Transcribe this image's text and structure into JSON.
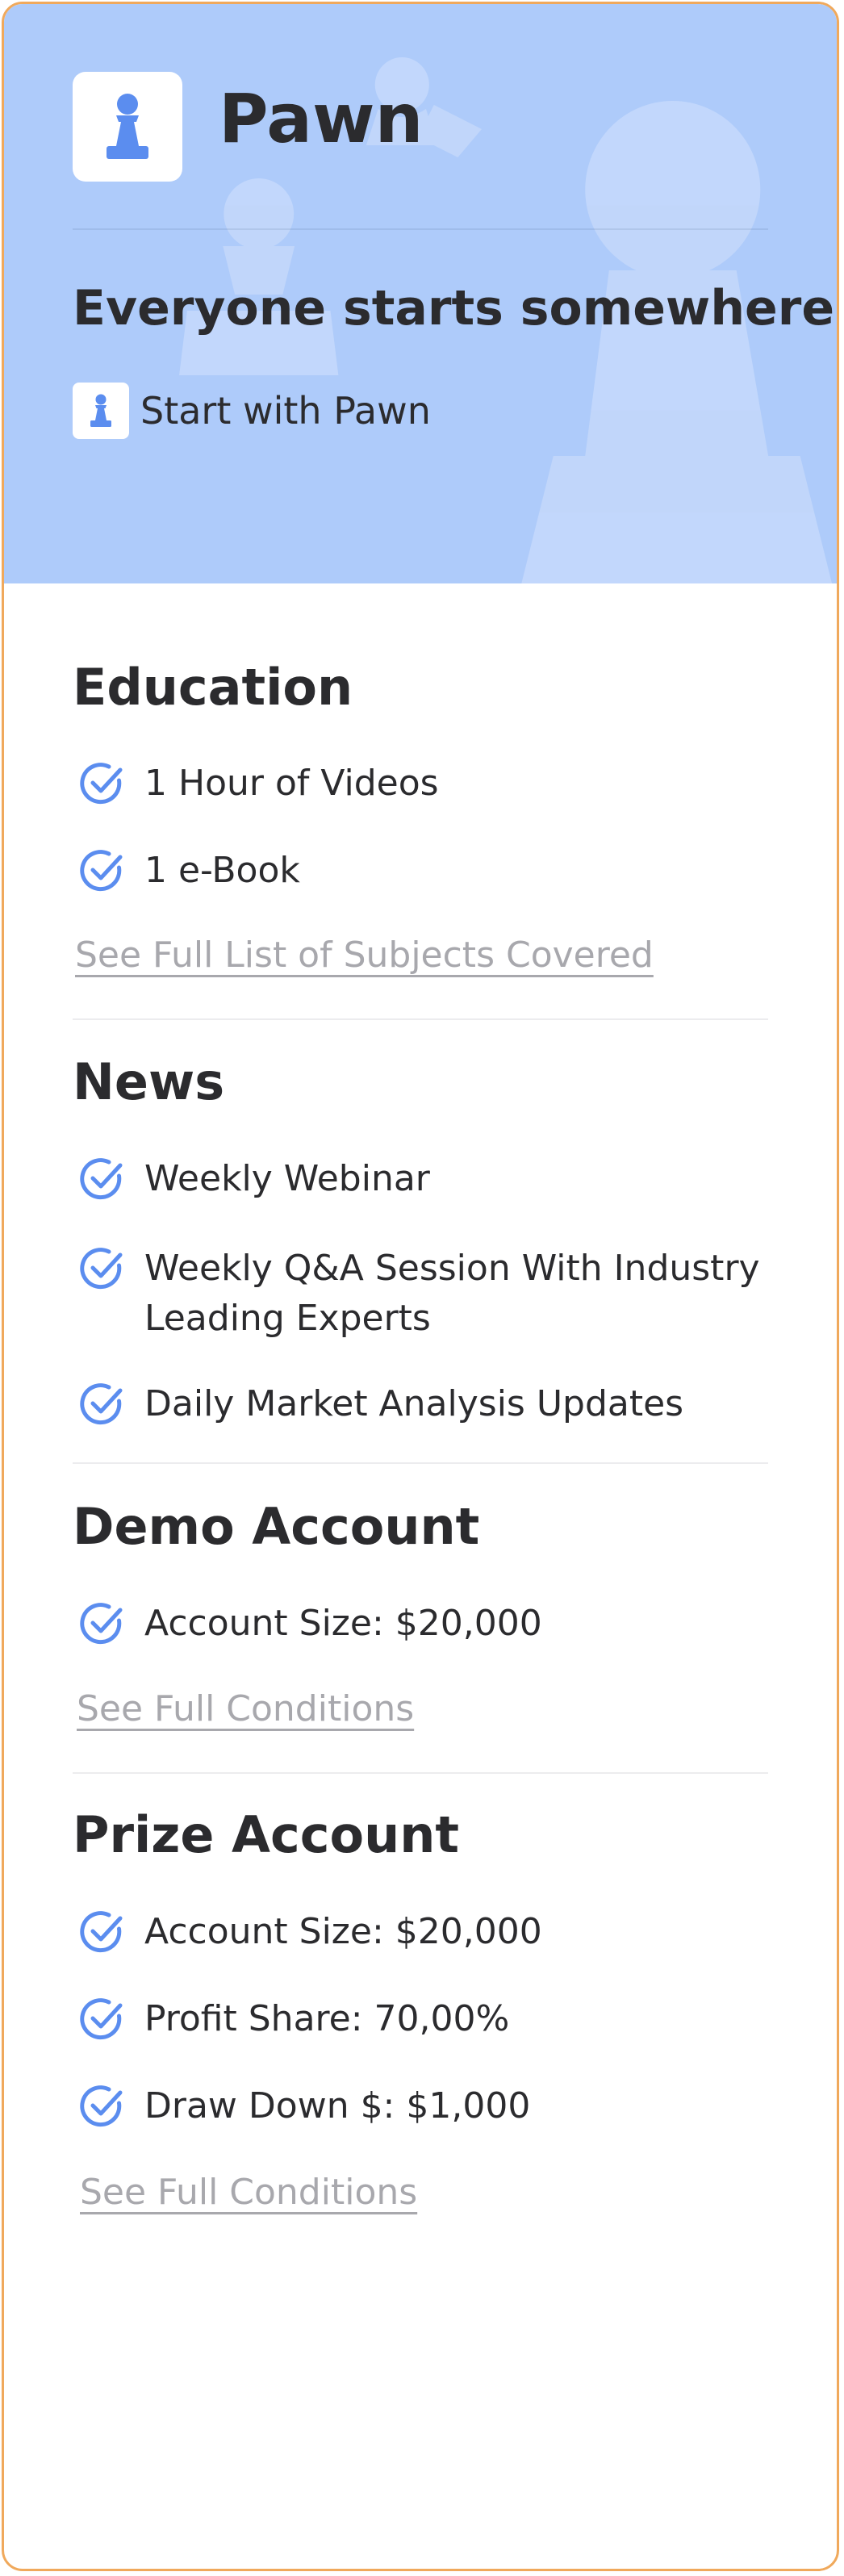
{
  "plan": {
    "name": "Pawn",
    "tagline": "Everyone starts somewhere",
    "cta_label": "Start with Pawn",
    "colors": {
      "hero_bg": "#aecbfa",
      "accent_blue": "#5b8def",
      "border": "#f0a95c",
      "link": "#a8a8ad"
    },
    "logo_icon": "pawn-icon"
  },
  "sections": {
    "education": {
      "title": "Education",
      "items": [
        "1 Hour of Videos",
        "1 e-Book"
      ],
      "link": "See Full List of Subjects Covered"
    },
    "news": {
      "title": "News",
      "items": [
        "Weekly Webinar",
        "Weekly Q&A Session With Industry Leading Experts",
        "Daily Market Analysis Updates"
      ]
    },
    "demo": {
      "title": "Demo Account",
      "items": [
        "Account Size: $20,000"
      ],
      "link": "See Full Conditions"
    },
    "prize": {
      "title": "Prize Account",
      "items": [
        "Account Size: $20,000",
        "Profit Share: 70,00%",
        "Draw Down $: $1,000"
      ],
      "link": "See Full Conditions"
    }
  }
}
